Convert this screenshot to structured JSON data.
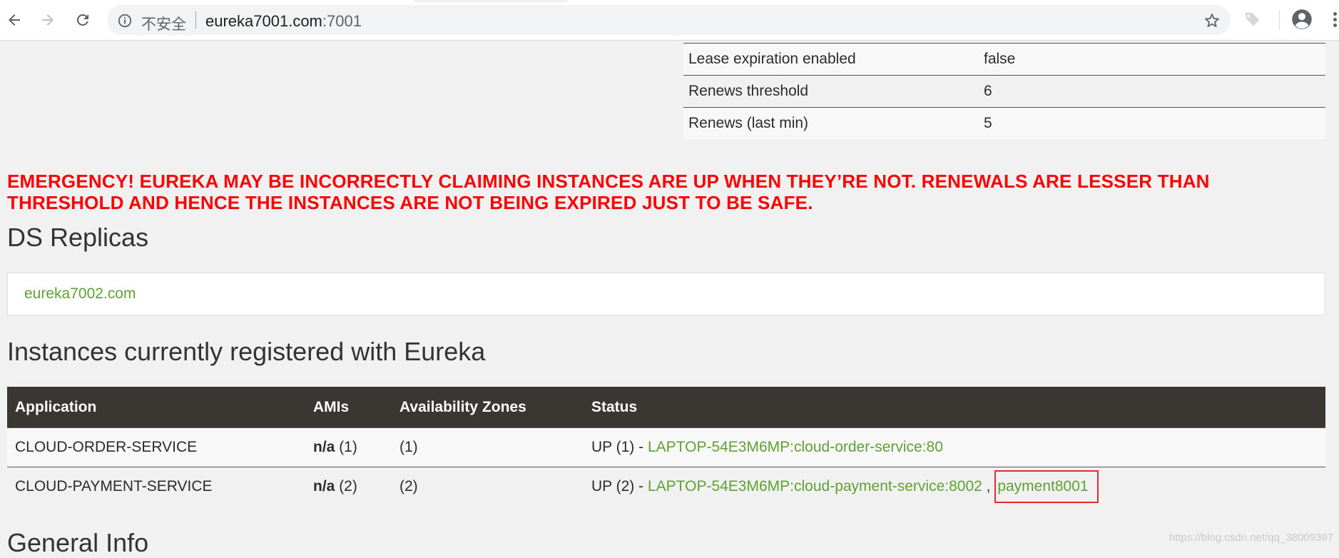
{
  "browser": {
    "security_label": "不安全",
    "url_host": "eureka7001.com",
    "url_port": ":7001"
  },
  "stats": [
    {
      "key": "Lease expiration enabled",
      "value": "false"
    },
    {
      "key": "Renews threshold",
      "value": "6"
    },
    {
      "key": "Renews (last min)",
      "value": "5"
    }
  ],
  "emergency": {
    "line1": "EMERGENCY! EUREKA MAY BE INCORRECTLY CLAIMING INSTANCES ARE UP WHEN THEY’RE NOT. RENEWALS ARE LESSER THAN",
    "line2": "THRESHOLD AND HENCE THE INSTANCES ARE NOT BEING EXPIRED JUST TO BE SAFE."
  },
  "replicas": {
    "title": "DS Replicas",
    "link": "eureka7002.com"
  },
  "instances": {
    "title": "Instances currently registered with Eureka",
    "headers": [
      "Application",
      "AMIs",
      "Availability Zones",
      "Status"
    ],
    "rows": [
      {
        "app": "CLOUD-ORDER-SERVICE",
        "amis_bold": "n/a",
        "amis_count": "(1)",
        "zones": "(1)",
        "status_prefix": "UP (1) - ",
        "link1": "LAPTOP-54E3M6MP:cloud-order-service:80"
      },
      {
        "app": "CLOUD-PAYMENT-SERVICE",
        "amis_bold": "n/a",
        "amis_count": "(2)",
        "zones": "(2)",
        "status_prefix": "UP (2) - ",
        "link1": "LAPTOP-54E3M6MP:cloud-payment-service:8002",
        "separator": " , ",
        "link2": "payment8001"
      }
    ]
  },
  "general_info": {
    "title": "General Info"
  },
  "watermark": "https://blog.csdn.net/qq_38009397"
}
